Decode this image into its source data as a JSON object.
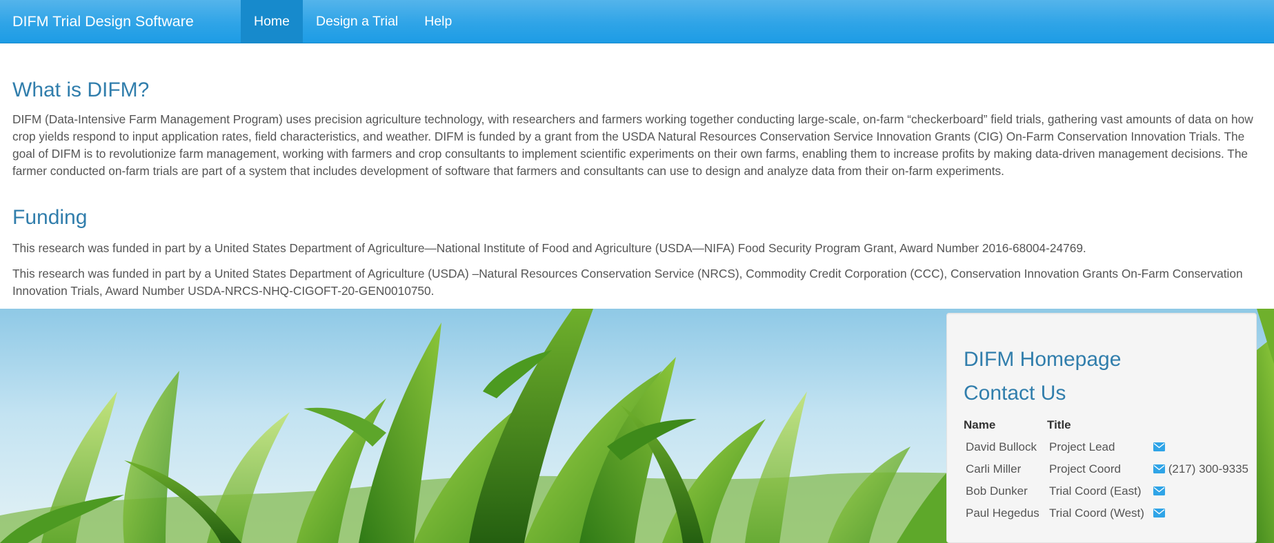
{
  "navbar": {
    "brand": "DIFM Trial Design Software",
    "items": [
      {
        "label": "Home",
        "active": true
      },
      {
        "label": "Design a Trial",
        "active": false
      },
      {
        "label": "Help",
        "active": false
      }
    ],
    "background_color": "#2fa4e7",
    "active_color": "#178acc"
  },
  "about": {
    "heading": "What is DIFM?",
    "body": "DIFM (Data-Intensive Farm Management Program) uses precision agriculture technology, with researchers and farmers working together conducting large-scale, on-farm “checkerboard” field trials, gathering vast amounts of data on how crop yields respond to input application rates, field characteristics, and weather. DIFM is funded by a grant from the USDA Natural Resources Conservation Service Innovation Grants (CIG) On-Farm Conservation Innovation Trials. The goal of DIFM is to revolutionize farm management, working with farmers and crop consultants to implement scientific experiments on their own farms, enabling them to increase profits by making data-driven management decisions. The farmer conducted on-farm trials are part of a system that includes development of software that farmers and consultants can use to design and analyze data from their on-farm experiments."
  },
  "funding": {
    "heading": "Funding",
    "paragraphs": [
      "This research was funded in part by a United States Department of Agriculture—National Institute of Food and Agriculture (USDA—NIFA) Food Security Program Grant, Award Number 2016-68004-24769.",
      "This research was funded in part by a United States Department of Agriculture (USDA) –Natural Resources Conservation Service (NRCS), Commodity Credit Corporation (CCC), Conservation Innovation Grants On-Farm Conservation Innovation Trials, Award Number USDA-NRCS-NHQ-CIGOFT-20-GEN0010750."
    ]
  },
  "panel": {
    "homepage_link": "DIFM Homepage",
    "contact_heading": "Contact Us",
    "columns": [
      "Name",
      "Title"
    ],
    "contacts": [
      {
        "name": "David Bullock",
        "title": "Project Lead",
        "phone": ""
      },
      {
        "name": "Carli Miller",
        "title": "Project Coord",
        "phone": "(217) 300-9335"
      },
      {
        "name": "Bob Dunker",
        "title": "Trial Coord (East)",
        "phone": ""
      },
      {
        "name": "Paul Hegedus",
        "title": "Trial Coord (West)",
        "phone": ""
      }
    ],
    "icon": "envelope-icon",
    "link_color": "#317eac",
    "icon_color": "#2fa4e7"
  },
  "hero": {
    "image": "corn-field-photo"
  }
}
